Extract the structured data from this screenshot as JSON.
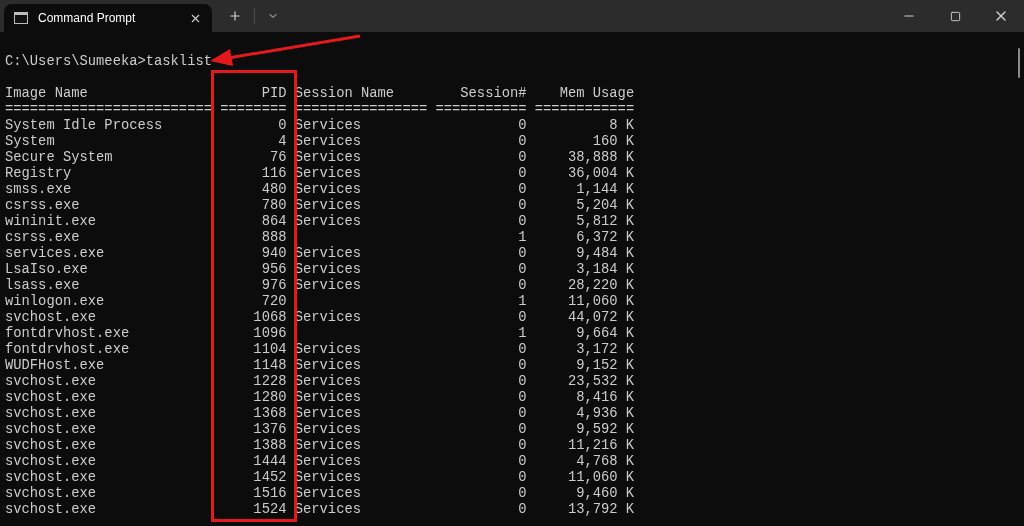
{
  "window": {
    "title": "Command Prompt"
  },
  "terminal": {
    "prompt": "C:\\Users\\Sumeeka>tasklist",
    "columns": [
      {
        "label": "Image Name",
        "rule": "========================="
      },
      {
        "label": "PID",
        "rule": "========"
      },
      {
        "label": "Session Name",
        "rule": "================"
      },
      {
        "label": "Session#",
        "rule": "==========="
      },
      {
        "label": "Mem Usage",
        "rule": "============"
      }
    ],
    "rows": [
      {
        "image_name": "System Idle Process",
        "pid": "0",
        "session_name": "Services",
        "session_num": "0",
        "mem_usage": "8 K"
      },
      {
        "image_name": "System",
        "pid": "4",
        "session_name": "Services",
        "session_num": "0",
        "mem_usage": "160 K"
      },
      {
        "image_name": "Secure System",
        "pid": "76",
        "session_name": "Services",
        "session_num": "0",
        "mem_usage": "38,888 K"
      },
      {
        "image_name": "Registry",
        "pid": "116",
        "session_name": "Services",
        "session_num": "0",
        "mem_usage": "36,004 K"
      },
      {
        "image_name": "smss.exe",
        "pid": "480",
        "session_name": "Services",
        "session_num": "0",
        "mem_usage": "1,144 K"
      },
      {
        "image_name": "csrss.exe",
        "pid": "780",
        "session_name": "Services",
        "session_num": "0",
        "mem_usage": "5,204 K"
      },
      {
        "image_name": "wininit.exe",
        "pid": "864",
        "session_name": "Services",
        "session_num": "0",
        "mem_usage": "5,812 K"
      },
      {
        "image_name": "csrss.exe",
        "pid": "888",
        "session_num": "1",
        "mem_usage": "6,372 K"
      },
      {
        "image_name": "services.exe",
        "pid": "940",
        "session_name": "Services",
        "session_num": "0",
        "mem_usage": "9,484 K"
      },
      {
        "image_name": "LsaIso.exe",
        "pid": "956",
        "session_name": "Services",
        "session_num": "0",
        "mem_usage": "3,184 K"
      },
      {
        "image_name": "lsass.exe",
        "pid": "976",
        "session_name": "Services",
        "session_num": "0",
        "mem_usage": "28,220 K"
      },
      {
        "image_name": "winlogon.exe",
        "pid": "720",
        "session_num": "1",
        "mem_usage": "11,060 K"
      },
      {
        "image_name": "svchost.exe",
        "pid": "1068",
        "session_name": "Services",
        "session_num": "0",
        "mem_usage": "44,072 K"
      },
      {
        "image_name": "fontdrvhost.exe",
        "pid": "1096",
        "session_num": "1",
        "mem_usage": "9,664 K"
      },
      {
        "image_name": "fontdrvhost.exe",
        "pid": "1104",
        "session_name": "Services",
        "session_num": "0",
        "mem_usage": "3,172 K"
      },
      {
        "image_name": "WUDFHost.exe",
        "pid": "1148",
        "session_name": "Services",
        "session_num": "0",
        "mem_usage": "9,152 K"
      },
      {
        "image_name": "svchost.exe",
        "pid": "1228",
        "session_name": "Services",
        "session_num": "0",
        "mem_usage": "23,532 K"
      },
      {
        "image_name": "svchost.exe",
        "pid": "1280",
        "session_name": "Services",
        "session_num": "0",
        "mem_usage": "8,416 K"
      },
      {
        "image_name": "svchost.exe",
        "pid": "1368",
        "session_name": "Services",
        "session_num": "0",
        "mem_usage": "4,936 K"
      },
      {
        "image_name": "svchost.exe",
        "pid": "1376",
        "session_name": "Services",
        "session_num": "0",
        "mem_usage": "9,592 K"
      },
      {
        "image_name": "svchost.exe",
        "pid": "1388",
        "session_name": "Services",
        "session_num": "0",
        "mem_usage": "11,216 K"
      },
      {
        "image_name": "svchost.exe",
        "pid": "1444",
        "session_name": "Services",
        "session_num": "0",
        "mem_usage": "4,768 K"
      },
      {
        "image_name": "svchost.exe",
        "pid": "1452",
        "session_name": "Services",
        "session_num": "0",
        "mem_usage": "11,060 K"
      },
      {
        "image_name": "svchost.exe",
        "pid": "1516",
        "session_name": "Services",
        "session_num": "0",
        "mem_usage": "9,460 K"
      },
      {
        "image_name": "svchost.exe",
        "pid": "1524",
        "session_name": "Services",
        "session_num": "0",
        "mem_usage": "13,792 K"
      }
    ]
  }
}
